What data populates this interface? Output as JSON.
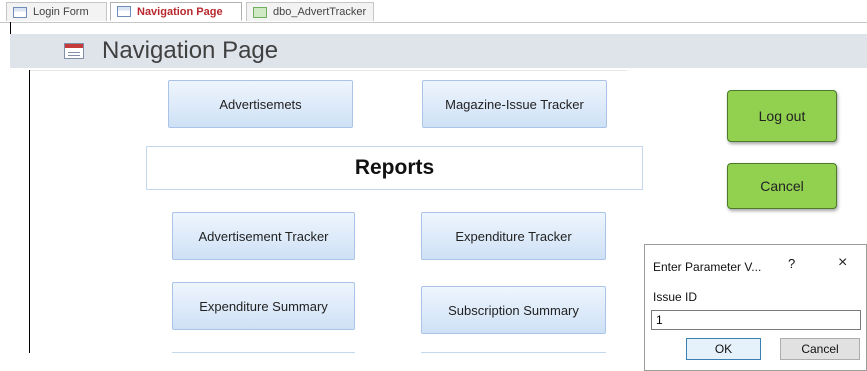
{
  "tabs": [
    {
      "label": "Login Form",
      "icon": "form-icon",
      "state": "inactive"
    },
    {
      "label": "Navigation Page",
      "icon": "form-icon",
      "state": "active"
    },
    {
      "label": "dbo_AdvertTracker",
      "icon": "table-icon",
      "state": "inactive"
    }
  ],
  "header": {
    "title": "Navigation Page",
    "icon": "form-icon"
  },
  "buttons": {
    "advertisements": "Advertisemets",
    "magazine_issue_tracker": "Magazine-Issue Tracker",
    "reports_heading": "Reports",
    "advertisement_tracker": "Advertisement Tracker",
    "expenditure_tracker": "Expenditure Tracker",
    "expenditure_summary": "Expenditure Summary",
    "subscription_summary": "Subscription Summary",
    "log_out": "Log out",
    "cancel": "Cancel"
  },
  "dialog": {
    "title": "Enter Parameter V...",
    "help": "?",
    "close": "×",
    "label": "Issue ID",
    "value": "1",
    "ok": "OK",
    "cancel": "Cancel"
  },
  "colors": {
    "active_tab_text": "#b8292f",
    "header_band": "#dfe3ea",
    "nav_button_fill": "#cfe1f6",
    "green_button": "#92d050"
  }
}
